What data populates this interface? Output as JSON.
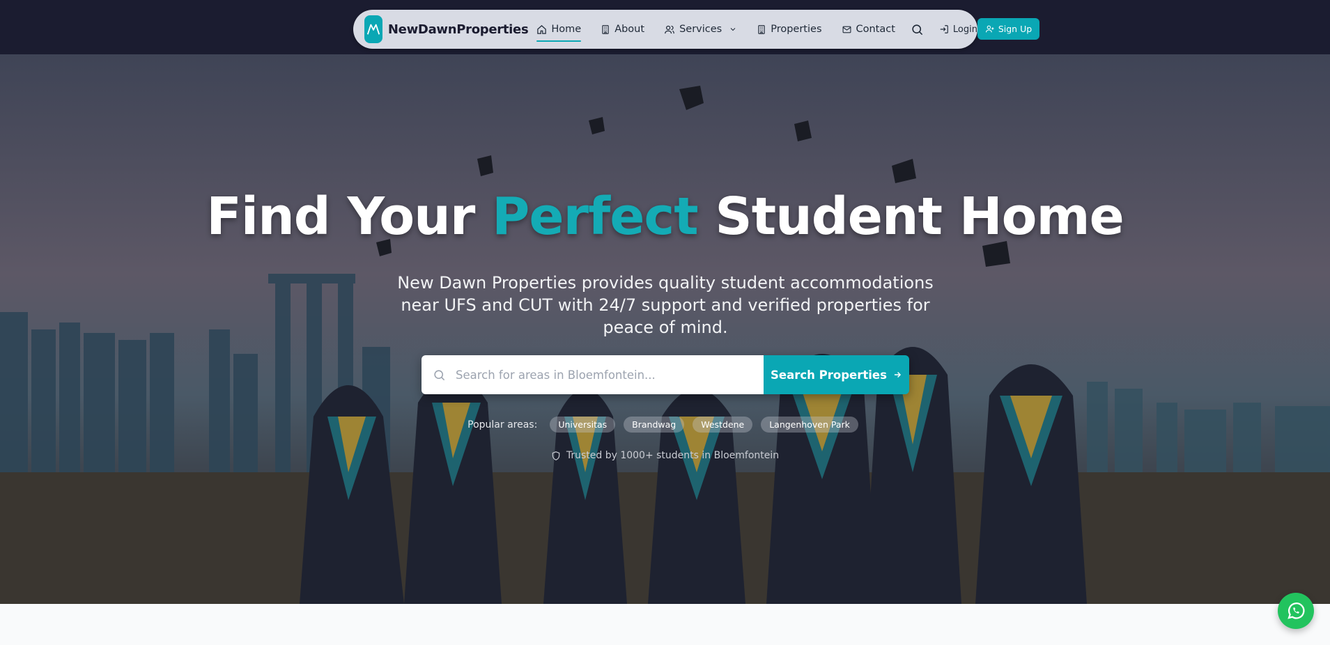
{
  "nav": {
    "brand": "NewDawnProperties",
    "items": [
      {
        "label": "Home",
        "icon": "home-icon",
        "active": true
      },
      {
        "label": "About",
        "icon": "building-icon"
      },
      {
        "label": "Services",
        "icon": "users-icon",
        "dropdown": true
      },
      {
        "label": "Properties",
        "icon": "building-icon"
      },
      {
        "label": "Contact",
        "icon": "mail-icon"
      }
    ],
    "login_label": "Login",
    "signup_label": "Sign Up"
  },
  "hero": {
    "title_part1": "Find Your ",
    "title_accent": "Perfect",
    "title_part2": " Student Home",
    "subtitle": "New Dawn Properties provides quality student accommodations near UFS and CUT with 24/7 support and verified properties for peace of mind.",
    "search_placeholder": "Search for areas in Bloemfontein...",
    "search_button": "Search Properties",
    "popular_label": "Popular areas:",
    "popular_areas": [
      "Universitas",
      "Brandwag",
      "Westdene",
      "Langenhoven Park"
    ],
    "trusted_text": "Trusted by 1000+ students in Bloemfontein"
  },
  "colors": {
    "accent": "#0aa7b4",
    "topbar": "#1b1c30",
    "whatsapp": "#22c35e"
  }
}
